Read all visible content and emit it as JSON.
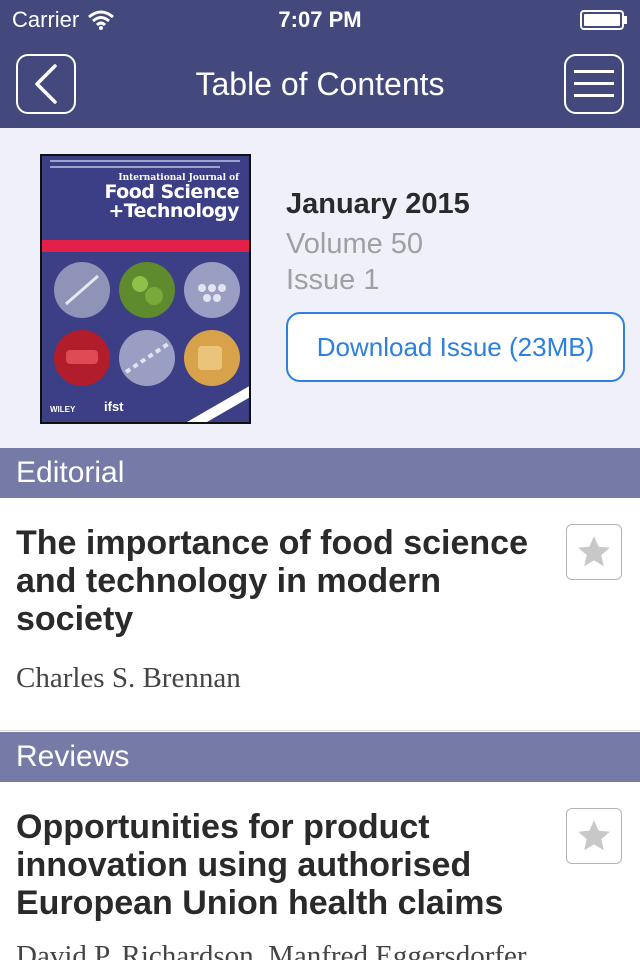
{
  "status_bar": {
    "carrier": "Carrier",
    "time": "7:07 PM",
    "icons": [
      "wifi-icon",
      "battery-icon"
    ]
  },
  "nav": {
    "title": "Table of Contents",
    "back_icon": "chevron-left-icon",
    "menu_icon": "hamburger-menu-icon"
  },
  "issue": {
    "date": "January 2015",
    "volume": "Volume 50",
    "issue": "Issue 1",
    "download_label": "Download Issue (23MB)",
    "cover": {
      "journal_intl": "International Journal of",
      "journal_line1": "Food Science",
      "journal_line2": "+Technology",
      "publisher": "WILEY",
      "society": "ifst"
    }
  },
  "sections": [
    {
      "heading": "Editorial",
      "articles": [
        {
          "title": "The importance of food science and technology in modern society",
          "authors": "Charles S. Brennan",
          "favorite_icon": "star-icon"
        }
      ]
    },
    {
      "heading": "Reviews",
      "articles": [
        {
          "title": "Opportunities for product innovation using authorised European Union health claims",
          "authors": "David P. Richardson, Manfred Eggersdorfer",
          "favorite_icon": "star-icon"
        }
      ]
    }
  ],
  "colors": {
    "bar": "#43497c",
    "section_header": "#757ba6",
    "header_bg": "#eff0f9",
    "accent": "#2d7fe0"
  }
}
